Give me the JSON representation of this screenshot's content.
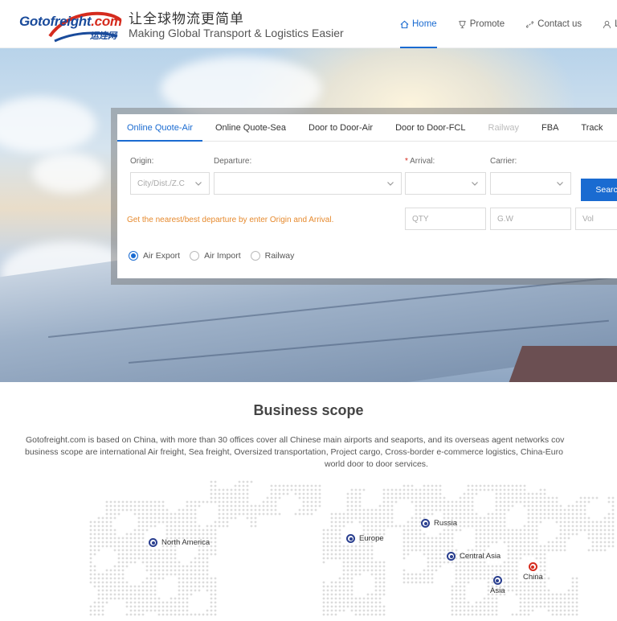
{
  "header": {
    "logo_text_main": "Gotofreight",
    "logo_text_suffix": ".com",
    "logo_cn": "运连网",
    "slogan_cn": "让全球物流更简单",
    "slogan_en": "Making Global Transport & Logistics Easier",
    "nav": [
      {
        "label": "Home",
        "icon": "home-icon",
        "active": true
      },
      {
        "label": "Promote",
        "icon": "trophy-icon",
        "active": false
      },
      {
        "label": "Contact us",
        "icon": "link-icon",
        "active": false
      },
      {
        "label": "Lo",
        "icon": "user-icon",
        "active": false
      }
    ]
  },
  "quote": {
    "tabs": [
      "Online Quote-Air",
      "Online Quote-Sea",
      "Door to Door-Air",
      "Door to Door-FCL",
      "Railway",
      "FBA",
      "Track"
    ],
    "origin_label": "Origin:",
    "origin_placeholder": "City/Dist./Z.C",
    "departure_label": "Departure:",
    "arrival_label": "Arrival:",
    "arrival_required": "*",
    "carrier_label": "Carrier:",
    "search_label": "Search",
    "hint": "Get the nearest/best departure by enter Origin and Arrival.",
    "qty_placeholder": "QTY",
    "gw_placeholder": "G.W",
    "vol_placeholder": "Vol",
    "radios": [
      {
        "label": "Air Export",
        "checked": true
      },
      {
        "label": "Air Import",
        "checked": false
      },
      {
        "label": "Railway",
        "checked": false
      }
    ]
  },
  "scope": {
    "title": "Business scope",
    "line1": "Gotofreight.com is based on China, with more than 30 offices cover all Chinese main airports and seaports, and its overseas agent networks cov",
    "line2": "business scope are international Air freight, Sea freight, Oversized transportation, Project cargo, Cross-border e-commerce logistics, China-Euro",
    "line3": "world door to door services.",
    "markers": [
      "North America",
      "Europe",
      "Russia",
      "Central Asia",
      "China",
      "Asia"
    ]
  },
  "colors": {
    "accent": "#1a6bd1",
    "brand_blue": "#1a4b9b",
    "brand_red": "#d52b1e",
    "hint_orange": "#e68a2e",
    "marker": "#2a3f8f"
  }
}
